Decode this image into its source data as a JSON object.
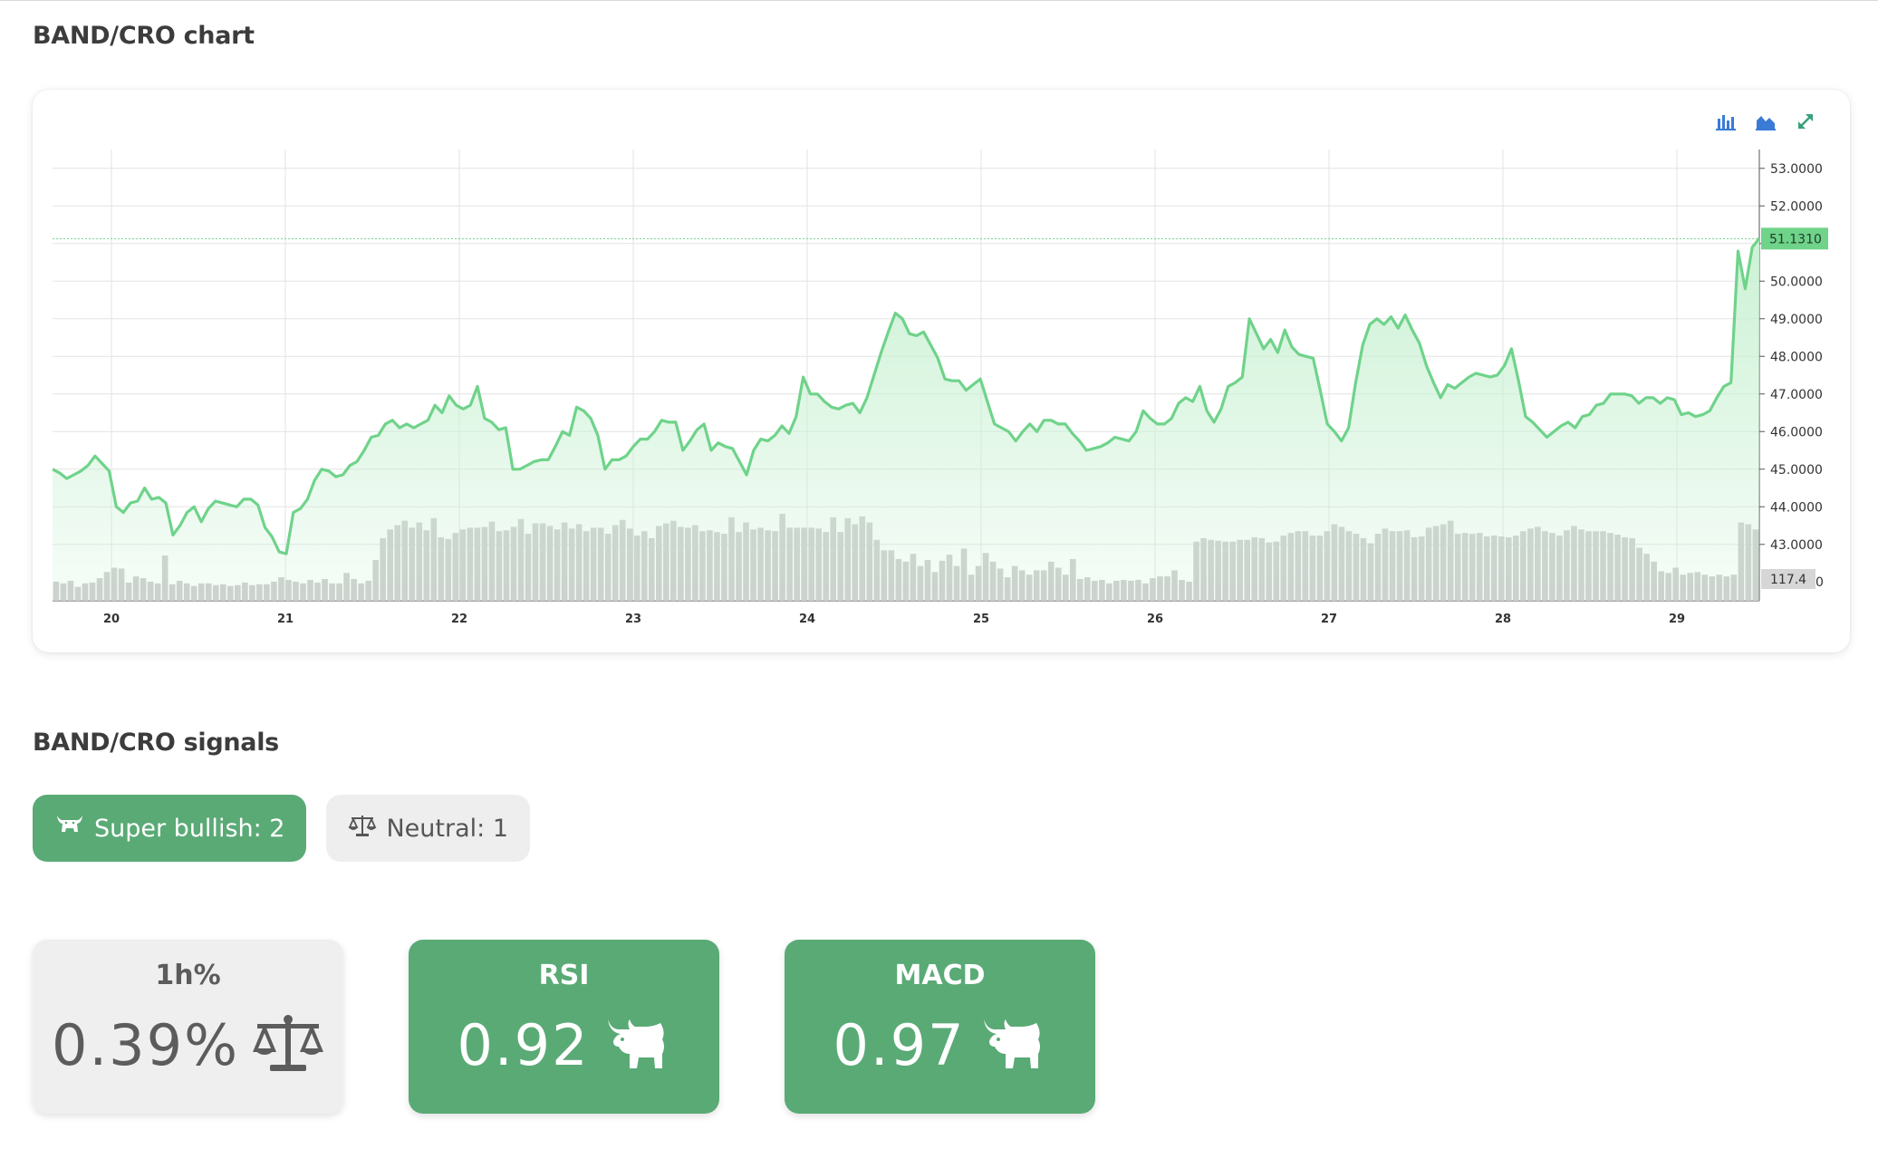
{
  "chart_section": {
    "title": "BAND/CRO chart"
  },
  "signals_section": {
    "title": "BAND/CRO signals"
  },
  "signal_pills": [
    {
      "label": "Super bullish: 2",
      "icon": "bull-icon",
      "color": "#5aaa76"
    },
    {
      "label": "Neutral: 1",
      "icon": "scales-icon",
      "color": "#eeeeee"
    }
  ],
  "indicator_cards": [
    {
      "label": "1h%",
      "value": "0.39%",
      "icon": "scales-icon",
      "status": "neutral"
    },
    {
      "label": "RSI",
      "value": "0.92",
      "icon": "bull-icon",
      "status": "bullish"
    },
    {
      "label": "MACD",
      "value": "0.97",
      "icon": "bull-icon",
      "status": "bullish"
    }
  ],
  "toolbar": {
    "icons": [
      "bar-chart-icon",
      "area-chart-icon",
      "expand-icon"
    ],
    "accent": "#3a7bd5"
  },
  "chart_data": {
    "type": "area",
    "x_ticks": [
      "20",
      "21",
      "22",
      "23",
      "24",
      "25",
      "26",
      "27",
      "28",
      "29"
    ],
    "y_ticks": [
      "53.0000",
      "52.0000",
      "51.0000",
      "50.0000",
      "49.0000",
      "48.0000",
      "47.0000",
      "46.0000",
      "45.0000",
      "44.0000",
      "43.0000"
    ],
    "y_major_values": [
      53,
      52,
      51,
      50,
      49,
      48,
      47,
      46,
      45,
      44,
      43
    ],
    "ylim": [
      41.5,
      53.5
    ],
    "last_price": "51.1310",
    "last_price_value": 51.131,
    "volume_label": "117.4",
    "volume_axis_zero": "0",
    "line_color": "#6fd38a",
    "fill_color": "#c9f1d3",
    "volume_color": "#cccccc",
    "price_series": [
      45.0,
      44.9,
      44.75,
      44.85,
      44.95,
      45.1,
      45.35,
      45.15,
      44.95,
      44.0,
      43.85,
      44.1,
      44.15,
      44.5,
      44.2,
      44.25,
      44.1,
      43.25,
      43.5,
      43.85,
      44.0,
      43.6,
      43.95,
      44.15,
      44.1,
      44.05,
      44.0,
      44.2,
      44.2,
      44.05,
      43.45,
      43.2,
      42.8,
      42.75,
      43.85,
      43.95,
      44.2,
      44.7,
      45.0,
      44.95,
      44.8,
      44.85,
      45.1,
      45.2,
      45.5,
      45.85,
      45.9,
      46.2,
      46.3,
      46.1,
      46.2,
      46.1,
      46.2,
      46.3,
      46.7,
      46.5,
      46.95,
      46.7,
      46.6,
      46.7,
      47.2,
      46.35,
      46.25,
      46.05,
      46.1,
      45.0,
      45.0,
      45.1,
      45.2,
      45.25,
      45.25,
      45.6,
      46.0,
      45.9,
      46.65,
      46.55,
      46.35,
      45.9,
      45.0,
      45.25,
      45.25,
      45.35,
      45.6,
      45.8,
      45.8,
      46.0,
      46.3,
      46.25,
      46.25,
      45.5,
      45.75,
      46.05,
      46.2,
      45.5,
      45.7,
      45.6,
      45.55,
      45.2,
      44.85,
      45.5,
      45.8,
      45.75,
      45.9,
      46.15,
      45.95,
      46.4,
      47.45,
      47.0,
      47.0,
      46.8,
      46.65,
      46.6,
      46.7,
      46.75,
      46.5,
      46.9,
      47.5,
      48.1,
      48.65,
      49.15,
      49.0,
      48.6,
      48.55,
      48.65,
      48.3,
      47.95,
      47.4,
      47.35,
      47.35,
      47.1,
      47.25,
      47.4,
      46.8,
      46.2,
      46.1,
      46.0,
      45.75,
      46.0,
      46.2,
      46.0,
      46.3,
      46.3,
      46.2,
      46.2,
      45.95,
      45.75,
      45.5,
      45.55,
      45.6,
      45.7,
      45.85,
      45.8,
      45.75,
      46.0,
      46.55,
      46.35,
      46.2,
      46.2,
      46.35,
      46.75,
      46.9,
      46.8,
      47.2,
      46.55,
      46.25,
      46.6,
      47.2,
      47.3,
      47.45,
      49.0,
      48.6,
      48.2,
      48.45,
      48.1,
      48.7,
      48.25,
      48.05,
      48.0,
      47.95,
      47.1,
      46.2,
      46.0,
      45.75,
      46.1,
      47.3,
      48.3,
      48.85,
      49.0,
      48.85,
      49.05,
      48.75,
      49.1,
      48.7,
      48.35,
      47.75,
      47.3,
      46.9,
      47.25,
      47.15,
      47.3,
      47.45,
      47.55,
      47.5,
      47.45,
      47.5,
      47.75,
      48.2,
      47.35,
      46.4,
      46.25,
      46.05,
      45.85,
      46.0,
      46.15,
      46.25,
      46.1,
      46.4,
      46.45,
      46.7,
      46.75,
      47.0,
      47.0,
      47.0,
      46.95,
      46.75,
      46.9,
      46.9,
      46.75,
      46.9,
      46.85,
      46.45,
      46.5,
      46.4,
      46.45,
      46.55,
      46.9,
      47.2,
      47.3,
      50.8,
      49.8,
      50.9,
      51.131
    ],
    "volume_series": [
      22,
      20,
      23,
      16,
      20,
      21,
      26,
      33,
      38,
      37,
      21,
      28,
      26,
      22,
      20,
      52,
      19,
      23,
      20,
      17,
      20,
      20,
      18,
      19,
      17,
      18,
      21,
      18,
      19,
      19,
      22,
      27,
      24,
      22,
      20,
      24,
      21,
      25,
      20,
      20,
      32,
      25,
      20,
      23,
      47,
      72,
      82,
      87,
      92,
      84,
      90,
      81,
      95,
      73,
      71,
      78,
      82,
      84,
      84,
      85,
      91,
      80,
      81,
      85,
      94,
      77,
      89,
      89,
      86,
      82,
      90,
      83,
      88,
      80,
      84,
      84,
      77,
      87,
      93,
      83,
      75,
      80,
      72,
      86,
      89,
      92,
      85,
      84,
      87,
      80,
      81,
      79,
      77,
      96,
      79,
      90,
      82,
      84,
      81,
      80,
      100,
      84,
      84,
      84,
      84,
      83,
      79,
      96,
      79,
      95,
      88,
      97,
      90,
      70,
      58,
      58,
      48,
      45,
      54,
      40,
      47,
      33,
      46,
      53,
      40,
      60,
      30,
      40,
      55,
      45,
      37,
      27,
      40,
      35,
      30,
      35,
      35,
      45,
      38,
      30,
      48,
      25,
      27,
      23,
      24,
      20,
      23,
      24,
      23,
      24,
      20,
      26,
      28,
      28,
      35,
      24,
      22,
      68,
      72,
      70,
      69,
      68,
      68,
      70,
      70,
      73,
      72,
      67,
      68,
      75,
      78,
      80,
      80,
      75,
      75,
      80,
      88,
      85,
      80,
      77,
      72,
      66,
      77,
      83,
      80,
      80,
      81,
      73,
      74,
      84,
      86,
      88,
      92,
      77,
      78,
      77,
      78,
      74,
      75,
      74,
      73,
      75,
      80,
      83,
      85,
      80,
      78,
      75,
      81,
      86,
      82,
      80,
      80,
      80,
      78,
      76,
      73,
      72,
      61,
      54,
      45,
      34,
      32,
      38,
      30,
      32,
      33,
      30,
      28,
      30,
      28,
      30,
      90,
      88,
      82
    ]
  }
}
